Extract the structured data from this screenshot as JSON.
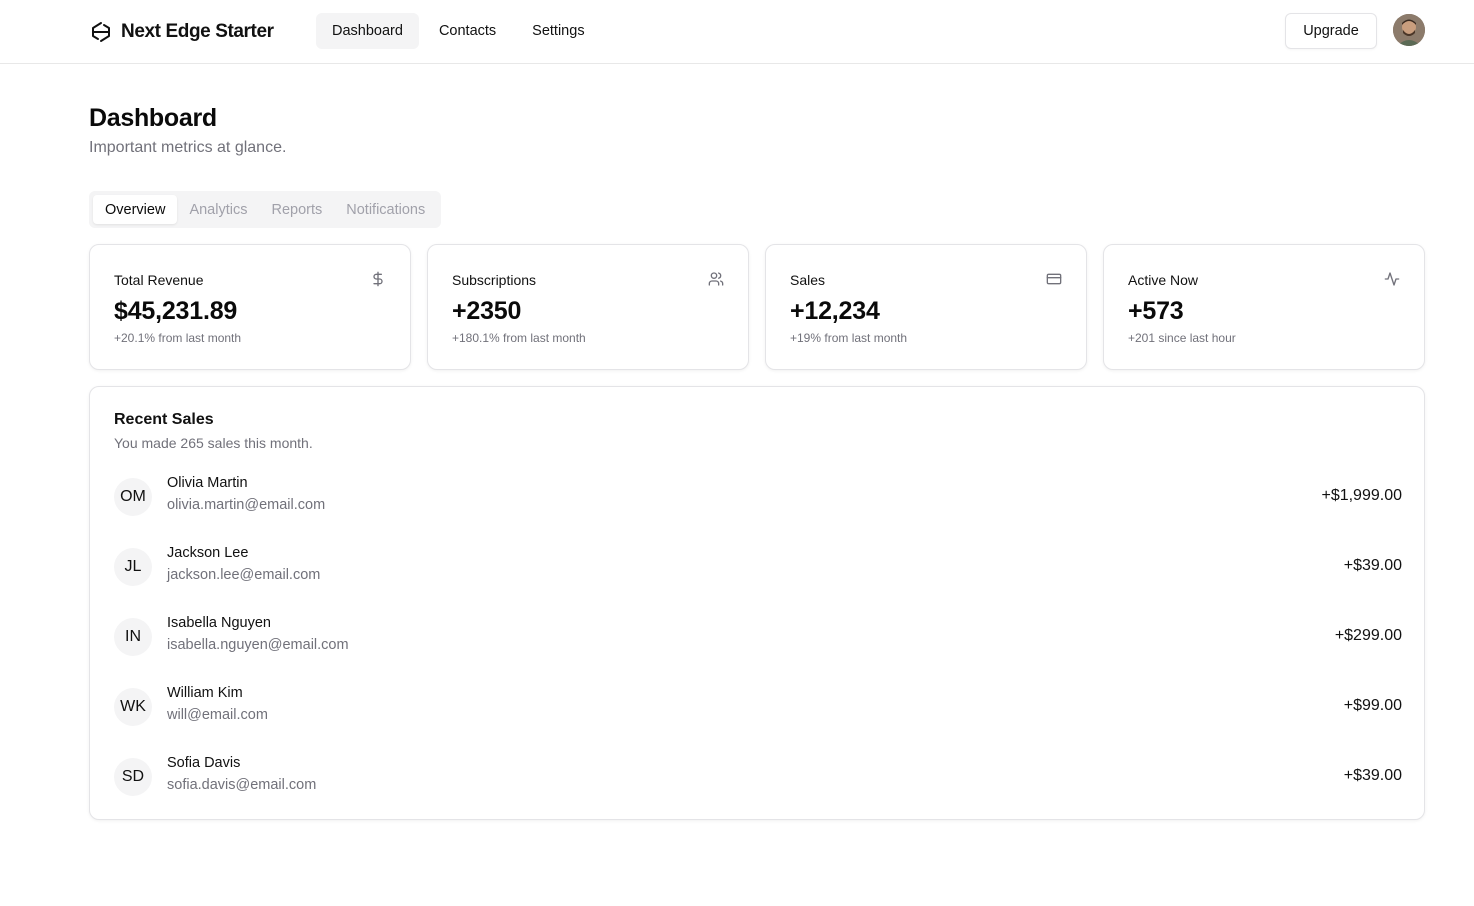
{
  "header": {
    "brand": "Next Edge Starter",
    "nav": [
      {
        "label": "Dashboard",
        "active": true
      },
      {
        "label": "Contacts",
        "active": false
      },
      {
        "label": "Settings",
        "active": false
      }
    ],
    "upgrade_label": "Upgrade"
  },
  "page": {
    "title": "Dashboard",
    "subtitle": "Important metrics at glance."
  },
  "tabs": [
    {
      "label": "Overview",
      "active": true
    },
    {
      "label": "Analytics",
      "active": false
    },
    {
      "label": "Reports",
      "active": false
    },
    {
      "label": "Notifications",
      "active": false
    }
  ],
  "cards": [
    {
      "title": "Total Revenue",
      "value": "$45,231.89",
      "note": "+20.1% from last month",
      "icon": "dollar-icon"
    },
    {
      "title": "Subscriptions",
      "value": "+2350",
      "note": "+180.1% from last month",
      "icon": "users-icon"
    },
    {
      "title": "Sales",
      "value": "+12,234",
      "note": "+19% from last month",
      "icon": "credit-card-icon"
    },
    {
      "title": "Active Now",
      "value": "+573",
      "note": "+201 since last hour",
      "icon": "activity-icon"
    }
  ],
  "recent_sales": {
    "title": "Recent Sales",
    "subtitle": "You made 265 sales this month.",
    "rows": [
      {
        "initials": "OM",
        "name": "Olivia Martin",
        "email": "olivia.martin@email.com",
        "amount": "+$1,999.00"
      },
      {
        "initials": "JL",
        "name": "Jackson Lee",
        "email": "jackson.lee@email.com",
        "amount": "+$39.00"
      },
      {
        "initials": "IN",
        "name": "Isabella Nguyen",
        "email": "isabella.nguyen@email.com",
        "amount": "+$299.00"
      },
      {
        "initials": "WK",
        "name": "William Kim",
        "email": "will@email.com",
        "amount": "+$99.00"
      },
      {
        "initials": "SD",
        "name": "Sofia Davis",
        "email": "sofia.davis@email.com",
        "amount": "+$39.00"
      }
    ]
  }
}
